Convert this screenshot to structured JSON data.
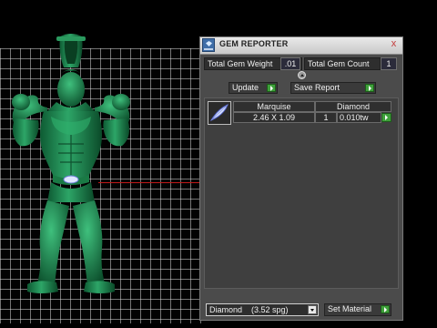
{
  "panel": {
    "title": "GEM REPORTER",
    "close_glyph": "x",
    "total_gem_weight_label": "Total Gem Weight",
    "total_gem_weight_value": ".01",
    "total_gem_count_label": "Total Gem Count",
    "total_gem_count_value": "1",
    "update_label": "Update",
    "save_report_label": "Save Report",
    "gems": [
      {
        "cut": "Marquise",
        "material": "Diamond",
        "size": "2.46 X 1.09",
        "quantity": "1",
        "weight": "0.010tw"
      }
    ],
    "material_select_value": "Diamond    (3.52 spg)",
    "set_material_label": "Set Material"
  },
  "icons": {
    "app": "gem-reporter-app-icon",
    "close": "close-icon",
    "expand": "expand-icon",
    "go": "green-arrow-icon",
    "gem_thumbnail": "marquise-gem-icon",
    "dropdown": "chevron-down-icon"
  },
  "colors": {
    "model": "#1f8a52",
    "accent_green": "#3fa13b",
    "axis_red": "#c01818",
    "panel_bg": "#4b4b4b"
  }
}
